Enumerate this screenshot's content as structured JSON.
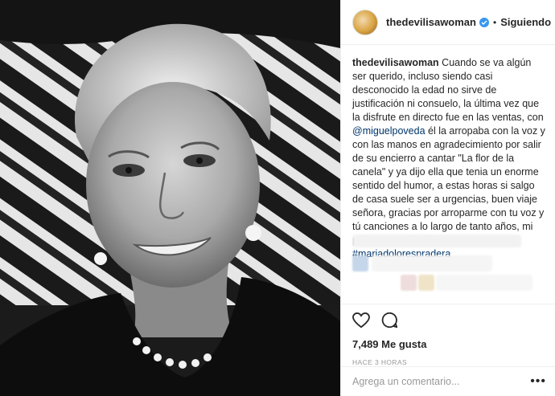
{
  "post": {
    "image_alt": "Retrato en blanco y negro de una mujer mayor sonriendo frente a un fondo de cebra"
  },
  "header": {
    "username": "thedevilisawoman",
    "separator": "•",
    "follow_label": "Siguiendo",
    "icons": {
      "avatar": "avatar",
      "verified": "verified-badge-icon"
    }
  },
  "caption": {
    "username": "thedevilisawoman",
    "text_1": "Cuando se va algún ser querido, incluso siendo casi desconocido la edad no sirve de justificación ni consuelo, la última vez que la disfrute en directo fue en las ventas, con",
    "mention": "@miguelpoveda",
    "text_2": "él la arropaba con la voz y con las manos en agradecimiento por salir de su encierro a cantar \"La flor de la canela\" y ya dijo ella que tenia un enorme sentido del humor, a estas horas si salgo de casa suele ser a urgencias, buen viaje señora, gracias por arroparme con tu voz y tú canciones a lo largo de tanto años, mi pésame a la familia",
    "heart": "❤",
    "hashtag": "#mariadolorespradera"
  },
  "actions": {
    "icons": [
      "heart-icon",
      "comment-icon"
    ],
    "likes": "7,489 Me gusta",
    "timestamp": "HACE 3 HORAS"
  },
  "comment": {
    "placeholder": "Agrega un comentario...",
    "more": "•••"
  },
  "colors": {
    "link": "#003569",
    "verified": "#3897f0",
    "border": "#efefef",
    "muted": "#999999"
  }
}
